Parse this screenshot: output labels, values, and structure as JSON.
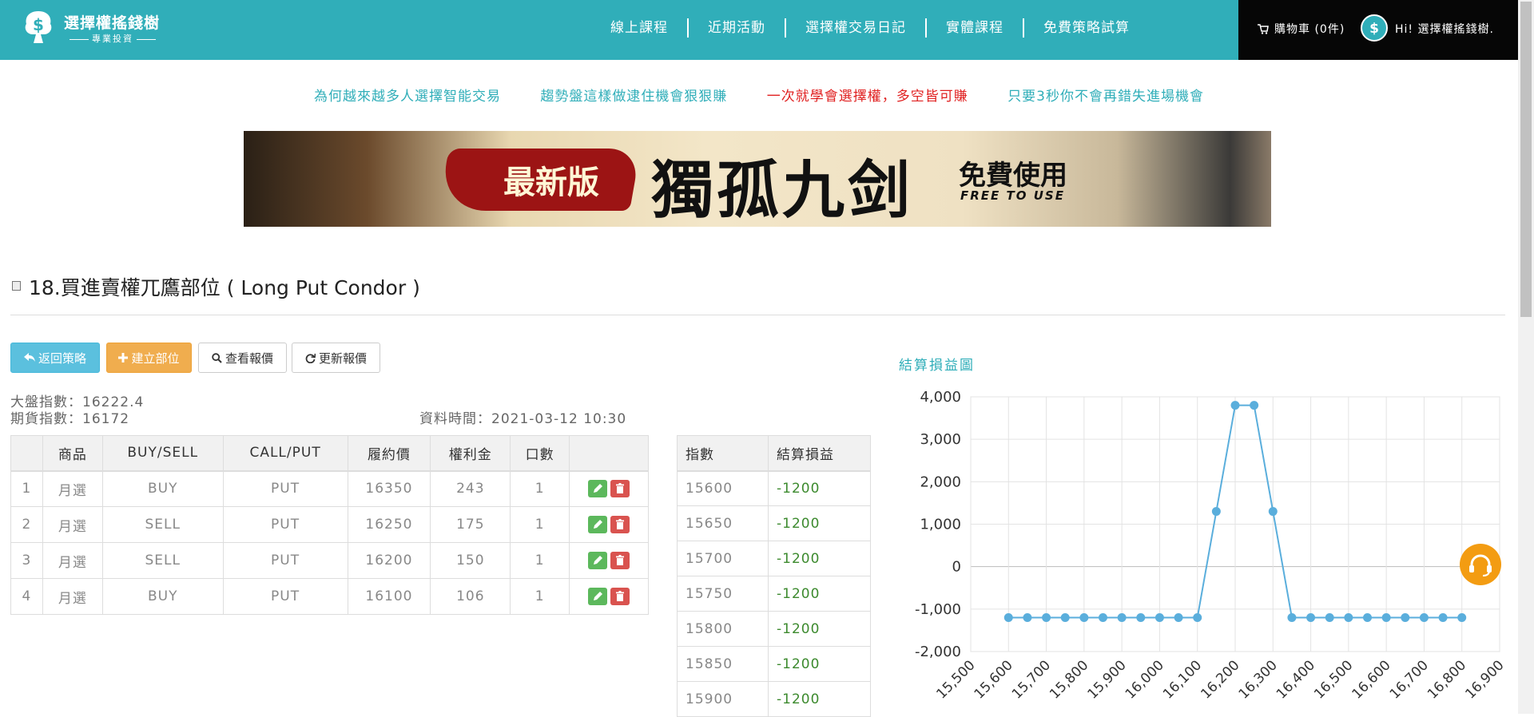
{
  "header": {
    "logo_title": "選擇權搖錢樹",
    "logo_subtitle": "專業投資",
    "nav": [
      "線上課程",
      "近期活動",
      "選擇權交易日記",
      "實體課程",
      "免費策略試算"
    ],
    "cart_label": "購物車 (0件)",
    "greeting": "Hi! 選擇權搖錢樹."
  },
  "promo_links": [
    {
      "text": "為何越來越多人選擇智能交易",
      "color": "#30aeb9"
    },
    {
      "text": "趨勢盤這樣做逮住機會狠狠賺",
      "color": "#30aeb9"
    },
    {
      "text": "一次就學會選擇權，多空皆可賺",
      "color": "#e02020"
    },
    {
      "text": "只要3秒你不會再錯失進場機會",
      "color": "#30aeb9"
    }
  ],
  "banner": {
    "tag": "最新版",
    "title": "獨孤九剑",
    "free": "免費使用",
    "free_en": "FREE TO USE"
  },
  "page_title": "18.買進賣權兀鷹部位 ( Long Put Condor )",
  "buttons": {
    "back": "返回策略",
    "build": "建立部位",
    "view_quote": "查看報價",
    "refresh_quote": "更新報價"
  },
  "info": {
    "index_label": "大盤指數：16222.4",
    "futures_label": "期貨指數：16172",
    "data_time": "資料時間：2021-03-12 10:30"
  },
  "positions": {
    "headers": [
      "",
      "商品",
      "BUY/SELL",
      "CALL/PUT",
      "履約價",
      "權利金",
      "口數",
      ""
    ],
    "rows": [
      {
        "no": "1",
        "product": "月選",
        "side": "BUY",
        "type": "PUT",
        "strike": "16350",
        "premium": "243",
        "qty": "1"
      },
      {
        "no": "2",
        "product": "月選",
        "side": "SELL",
        "type": "PUT",
        "strike": "16250",
        "premium": "175",
        "qty": "1"
      },
      {
        "no": "3",
        "product": "月選",
        "side": "SELL",
        "type": "PUT",
        "strike": "16200",
        "premium": "150",
        "qty": "1"
      },
      {
        "no": "4",
        "product": "月選",
        "side": "BUY",
        "type": "PUT",
        "strike": "16100",
        "premium": "106",
        "qty": "1"
      }
    ]
  },
  "pnl_table": {
    "headers": [
      "指數",
      "結算損益"
    ],
    "rows": [
      {
        "index": "15600",
        "pnl": "-1200"
      },
      {
        "index": "15650",
        "pnl": "-1200"
      },
      {
        "index": "15700",
        "pnl": "-1200"
      },
      {
        "index": "15750",
        "pnl": "-1200"
      },
      {
        "index": "15800",
        "pnl": "-1200"
      },
      {
        "index": "15850",
        "pnl": "-1200"
      },
      {
        "index": "15900",
        "pnl": "-1200"
      }
    ]
  },
  "chart_title": "結算損益圖",
  "chart_data": {
    "type": "line",
    "title": "結算損益圖",
    "x": [
      15600,
      15650,
      15700,
      15750,
      15800,
      15850,
      15900,
      15950,
      16000,
      16050,
      16100,
      16150,
      16200,
      16250,
      16300,
      16350,
      16400,
      16450,
      16500,
      16550,
      16600,
      16650,
      16700,
      16750,
      16800
    ],
    "y": [
      -1200,
      -1200,
      -1200,
      -1200,
      -1200,
      -1200,
      -1200,
      -1200,
      -1200,
      -1200,
      -1200,
      1300,
      3800,
      3800,
      1300,
      -1200,
      -1200,
      -1200,
      -1200,
      -1200,
      -1200,
      -1200,
      -1200,
      -1200,
      -1200
    ],
    "x_ticks": [
      "15,500",
      "15,600",
      "15,700",
      "15,800",
      "15,900",
      "16,000",
      "16,100",
      "16,200",
      "16,300",
      "16,400",
      "16,500",
      "16,600",
      "16,700",
      "16,800",
      "16,900"
    ],
    "x_tick_values": [
      15500,
      15600,
      15700,
      15800,
      15900,
      16000,
      16100,
      16200,
      16300,
      16400,
      16500,
      16600,
      16700,
      16800,
      16900
    ],
    "y_ticks": [
      "4,000",
      "3,000",
      "2,000",
      "1,000",
      "0",
      "-1,000",
      "-2,000"
    ],
    "y_tick_values": [
      4000,
      3000,
      2000,
      1000,
      0,
      -1000,
      -2000
    ],
    "xlim": [
      15500,
      16900
    ],
    "ylim": [
      -2000,
      4000
    ],
    "grid": true,
    "line_color": "#5aaedc"
  }
}
